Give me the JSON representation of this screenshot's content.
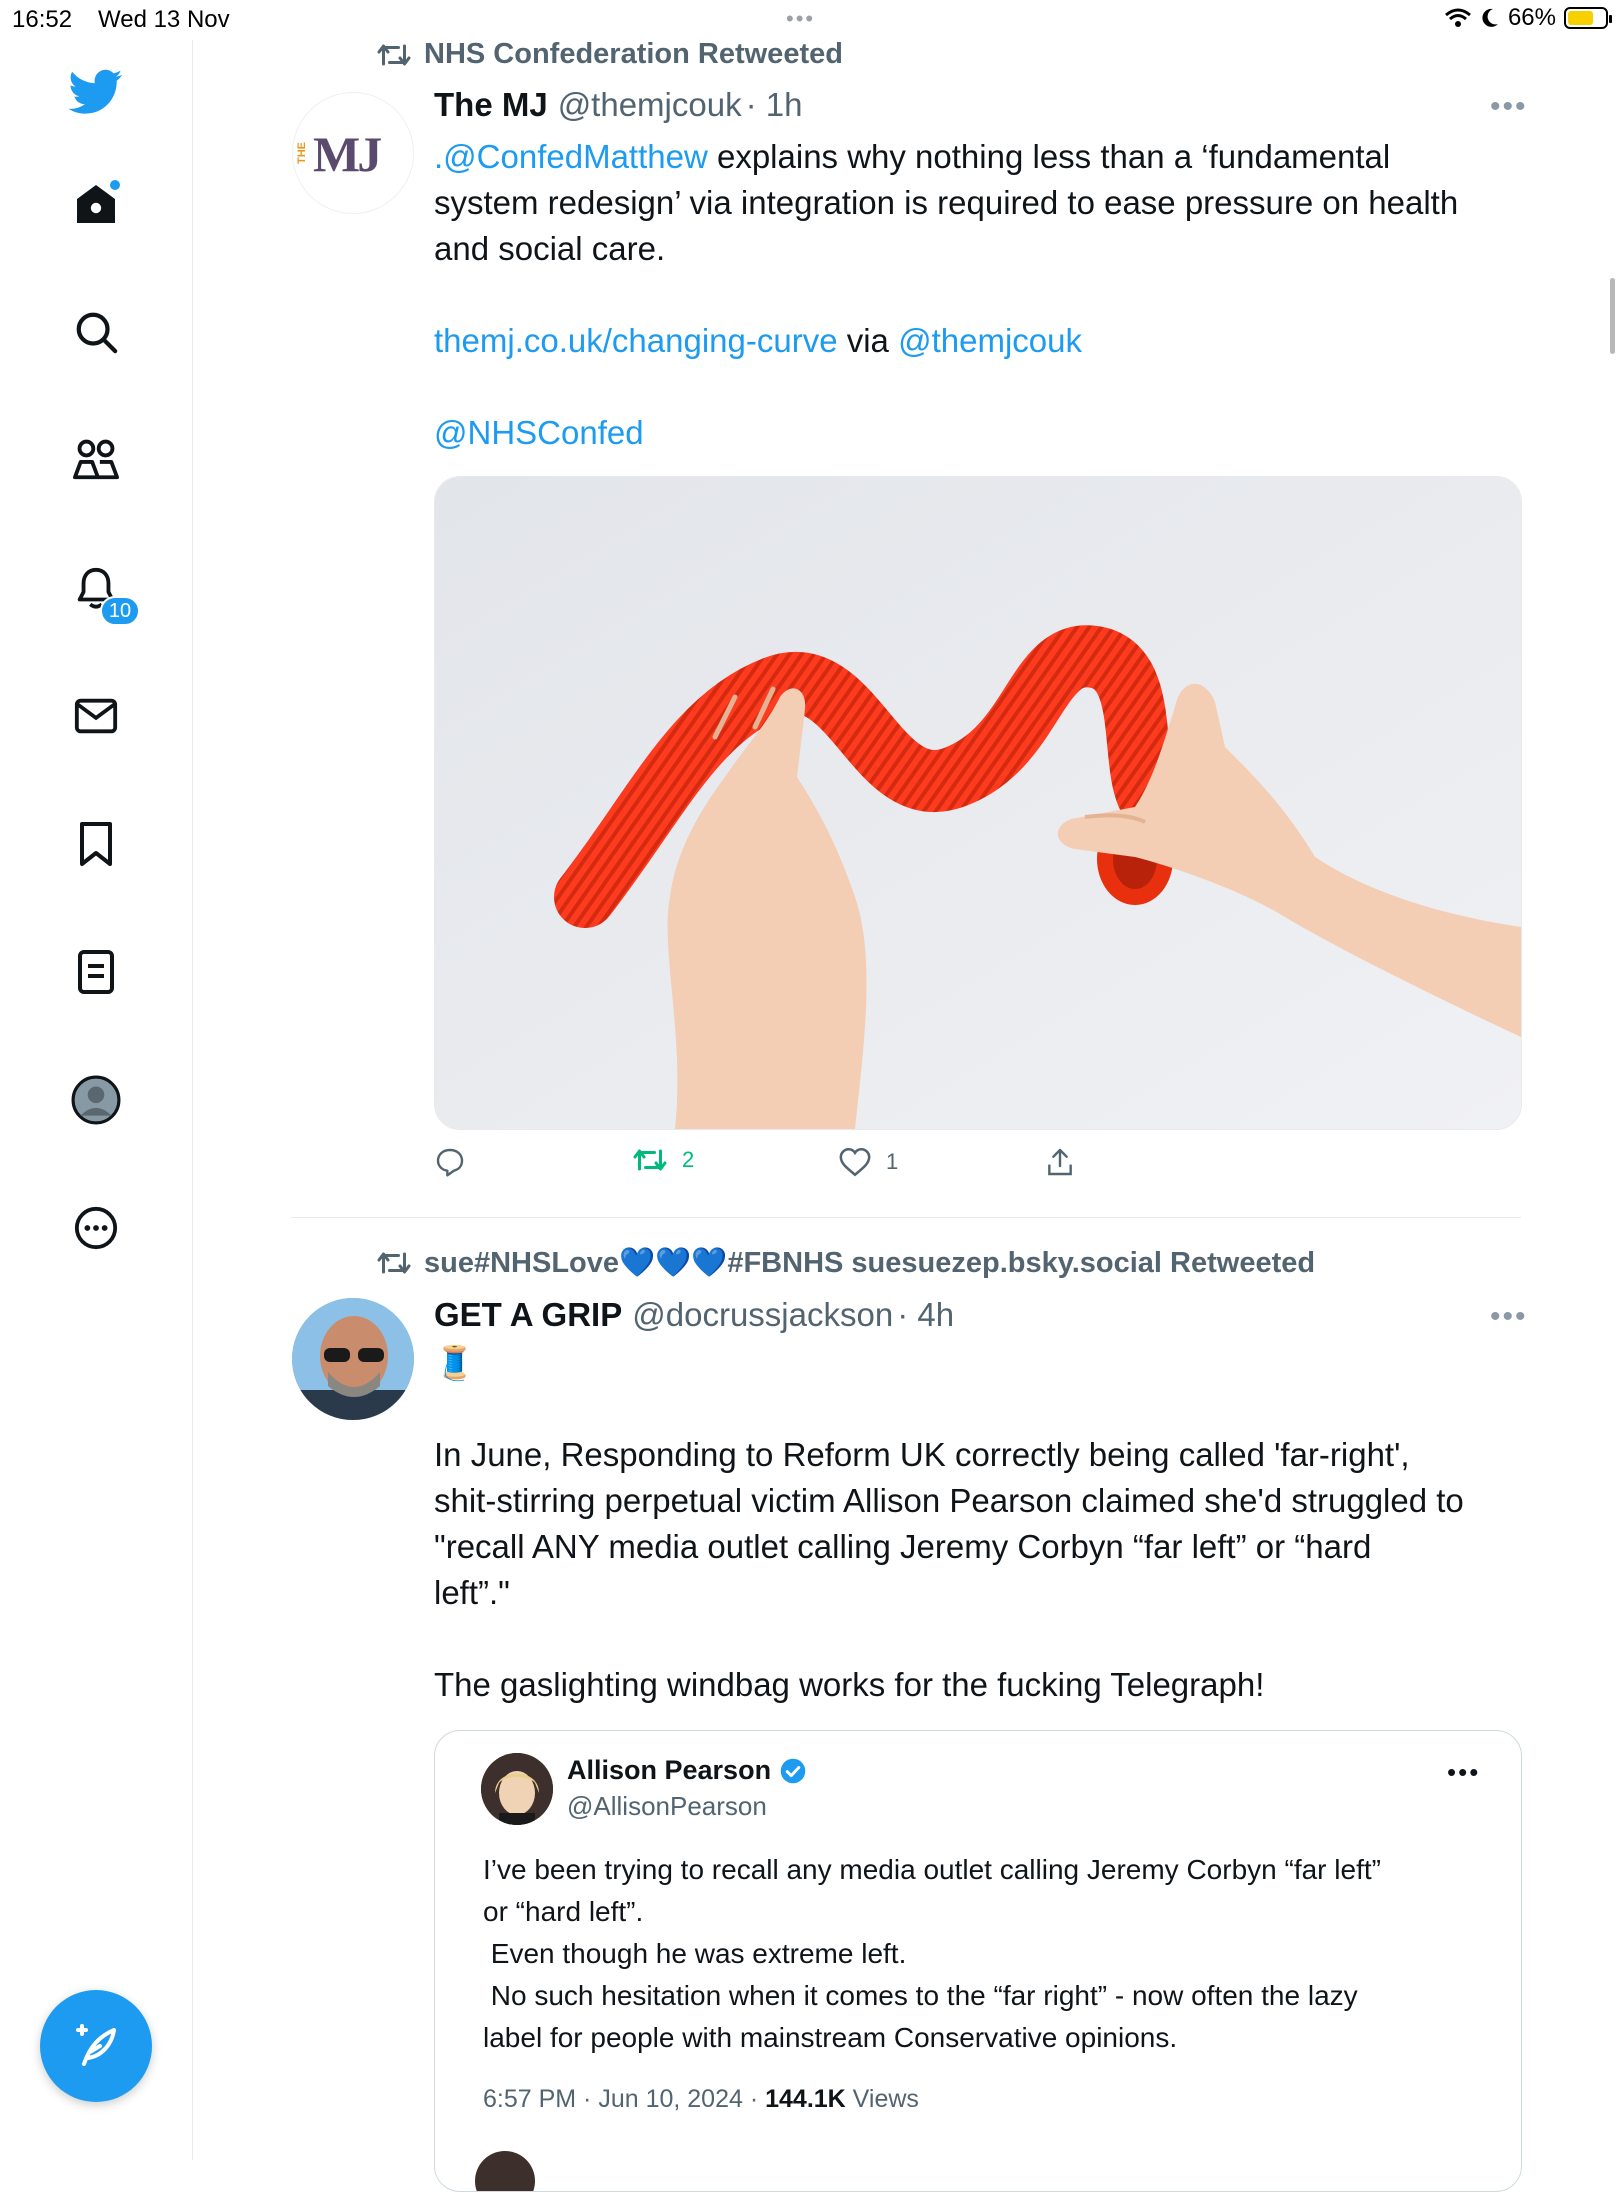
{
  "status_bar": {
    "time": "16:52",
    "date": "Wed 13 Nov",
    "battery": "66%"
  },
  "sidebar": {
    "items": [
      {
        "name": "home"
      },
      {
        "name": "explore"
      },
      {
        "name": "communities"
      },
      {
        "name": "notifications",
        "badge": "10"
      },
      {
        "name": "messages"
      },
      {
        "name": "bookmarks"
      },
      {
        "name": "lists"
      },
      {
        "name": "profile"
      },
      {
        "name": "more"
      }
    ],
    "compose_label": "New Tweet"
  },
  "tweets": [
    {
      "retweeted_by": "NHS Confederation Retweeted",
      "avatar_text": "MJ",
      "avatar_side_text": "THE",
      "name": "The MJ",
      "handle": "@themjcouk",
      "time": "· 1h",
      "text_mention": ".@ConfedMatthew",
      "text_line1": " explains why nothing less than a ‘fundamental",
      "text_line2": "system redesign’ via integration is required to ease pressure on health",
      "text_line3": "and social care.",
      "link": "themj.co.uk/changing-curve",
      "via": " via ",
      "via_handle": "@themjcouk",
      "tag": "@NHSConfed",
      "actions": {
        "replies": "",
        "retweets": "2",
        "likes": "1"
      }
    },
    {
      "retweeted_by": "sue#NHSLove💙💙💙#FBNHS suesuezep.bsky.social Retweeted",
      "name": "GET A GRIP",
      "handle": "@docrussjackson",
      "time": "· 4h",
      "emoji": "🧵",
      "p1_l1": "In June, Responding to Reform UK correctly being called 'far-right',",
      "p1_l2": "shit-stirring perpetual victim Allison Pearson claimed she'd struggled to",
      "p1_l3": "\"recall ANY media outlet calling Jeremy Corbyn “far left” or “hard",
      "p1_l4": "left”.\"",
      "p2": "The gaslighting windbag works for the fucking Telegraph!",
      "quote": {
        "name": "Allison Pearson",
        "handle": "@AllisonPearson",
        "l1": "I’ve been trying to recall any media outlet calling Jeremy Corbyn “far left”",
        "l2": "or “hard left”.",
        "l3": " Even though he was extreme left.",
        "l4": " No such hesitation when it comes to the “far right” - now often the lazy",
        "l5": "label for people with mainstream Conservative opinions.",
        "meta_time": "6:57 PM · Jun 10, 2024 · ",
        "views_count": "144.1K",
        "views_label": " Views"
      }
    }
  ],
  "colors": {
    "accent": "#1d9bf0",
    "retweet_green": "#00ba7c",
    "muted": "#536471",
    "tube_red": "#ff3b1f"
  }
}
